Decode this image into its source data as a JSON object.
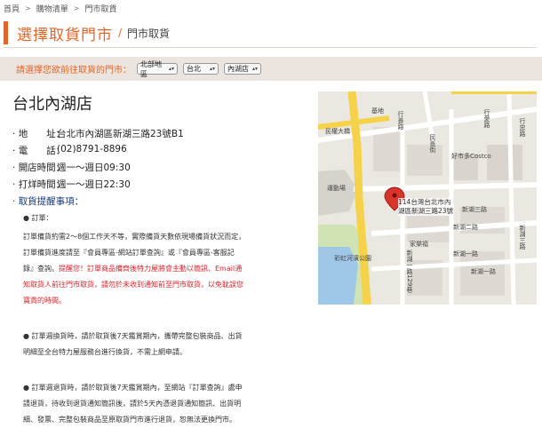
{
  "breadcrumb": {
    "items": [
      "首頁",
      "購物清單",
      "門市取貨"
    ],
    "separator": ">"
  },
  "title": {
    "main": "選擇取貨門市",
    "slash": "/",
    "sub": "門市取貨"
  },
  "store_select": {
    "label": "請選擇您欲前往取貨的門市：",
    "region": "北部地區",
    "city": "台北",
    "store": "內湖店"
  },
  "store": {
    "name": "台北內湖店",
    "address_label": "地　　址：",
    "address": "台北市內湖區新湖三路23號B1",
    "phone_label": "電　　話：",
    "phone": "(02)8791-8896",
    "open_label": "開店時間：",
    "open": "週一～週日09:30",
    "close_label": "打烊時間：",
    "close": "週一～週日22:30"
  },
  "notice": {
    "head": "取貨提醒事項：",
    "p1_title": "訂單：",
    "p1_l1": "訂單備貨約需2～8個工作天不等，實際備貨天數依現場備貨狀況而定，",
    "p1_l2": "訂單備貨進度請至『會員專區-網站訂單查詢』或『會員專區-客服記",
    "p1_l3a": "錄』查詢。",
    "p1_l3b": "提醒您！訂單商品備齊後特力屋將會主動以簡訊、Email通",
    "p1_l4": "知取貨人前往門市取貨，請勿於未收到通知前至門市取貨，以免耽誤您",
    "p1_l5": "寶貴的時間。",
    "p2_l1": "訂單週換貨時，請於取貨後7天鑑賞期內，攜帶完整包裝商品、出貨",
    "p2_l2": "明細至全台特力屋服務台進行換貨，不需上網申請。",
    "p3_l1": "訂單週退貨時，請於取貨後7天鑑賞期內，至網站『訂單查詢』處申",
    "p3_l2": "請退貨，待收到退貨通知簡訊後，請於5天內憑退貨通知簡訊、出貨明",
    "p3_l3": "細、發票、完整包裝商品至原取貨門市進行退貨，恕無法更換門市。"
  },
  "map": {
    "marker_line1": "114台灣台北市內",
    "marker_line2": "湖區新湖三路23號",
    "labels": {
      "minquan": "民權大橋",
      "gate": "基地",
      "costco": "好市多Costco",
      "stadium": "運動場",
      "shanshan": "家樂福",
      "park": "彩虹河濱公園",
      "xinhu2": "新湖二路",
      "xinhu3": "新湖三路",
      "xinhu1": "新湖一路",
      "xinhu1b": "新湖一路",
      "xinghu": "新湖一路129巷",
      "minshan": "民善街",
      "xingai": "行善路",
      "xingai2": "行愛路",
      "xingzhong": "行忠路",
      "xinhu3b": "新湖三路"
    }
  },
  "colors": {
    "accent": "#e0672b",
    "select_bg": "#ece4de",
    "notice_red": "#d8242a",
    "notice_head": "#1a3a7a",
    "map_road_main": "#f6d24a"
  }
}
